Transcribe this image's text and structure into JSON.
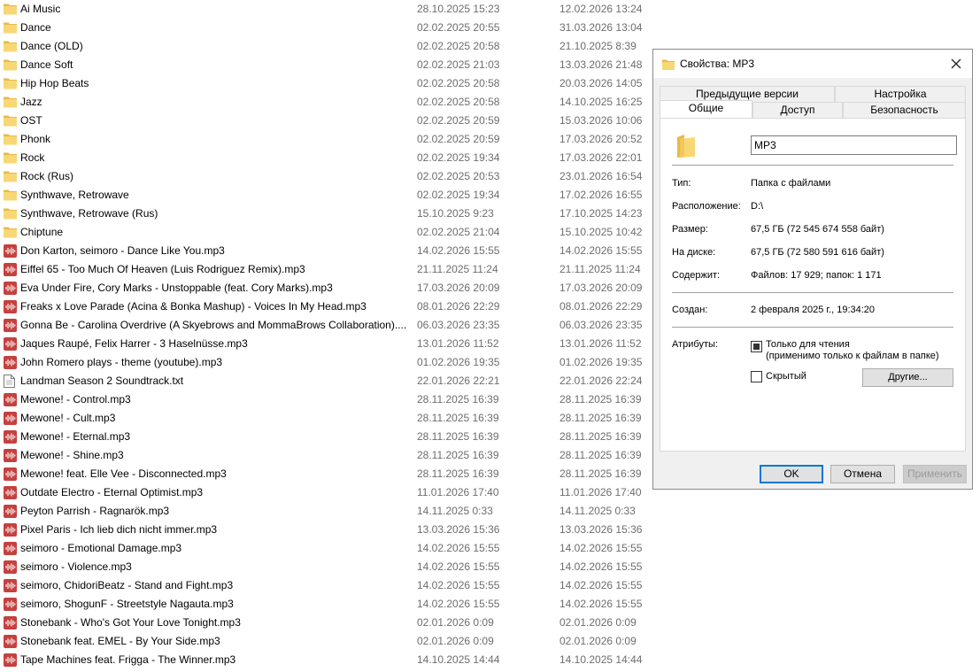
{
  "files": [
    {
      "name": "Ai Music",
      "type": "folder",
      "created": "28.10.2025 15:23",
      "modified": "12.02.2026 13:24"
    },
    {
      "name": "Dance",
      "type": "folder",
      "created": "02.02.2025 20:55",
      "modified": "31.03.2026 13:04"
    },
    {
      "name": "Dance (OLD)",
      "type": "folder",
      "created": "02.02.2025 20:58",
      "modified": "21.10.2025 8:39"
    },
    {
      "name": "Dance Soft",
      "type": "folder",
      "created": "02.02.2025 21:03",
      "modified": "13.03.2026 21:48"
    },
    {
      "name": "Hip Hop Beats",
      "type": "folder",
      "created": "02.02.2025 20:58",
      "modified": "20.03.2026 14:05"
    },
    {
      "name": "Jazz",
      "type": "folder",
      "created": "02.02.2025 20:58",
      "modified": "14.10.2025 16:25"
    },
    {
      "name": "OST",
      "type": "folder",
      "created": "02.02.2025 20:59",
      "modified": "15.03.2026 10:06"
    },
    {
      "name": "Phonk",
      "type": "folder",
      "created": "02.02.2025 20:59",
      "modified": "17.03.2026 20:52"
    },
    {
      "name": "Rock",
      "type": "folder",
      "created": "02.02.2025 19:34",
      "modified": "17.03.2026 22:01"
    },
    {
      "name": "Rock (Rus)",
      "type": "folder",
      "created": "02.02.2025 20:53",
      "modified": "23.01.2026 16:54"
    },
    {
      "name": "Synthwave, Retrowave",
      "type": "folder",
      "created": "02.02.2025 19:34",
      "modified": "17.02.2026 16:55"
    },
    {
      "name": "Synthwave, Retrowave (Rus)",
      "type": "folder",
      "created": "15.10.2025 9:23",
      "modified": "17.10.2025 14:23"
    },
    {
      "name": "Chiptune",
      "type": "folder",
      "created": "02.02.2025 21:04",
      "modified": "15.10.2025 10:42"
    },
    {
      "name": "Don Karton, seimoro - Dance Like You.mp3",
      "type": "audio",
      "created": "14.02.2026 15:55",
      "modified": "14.02.2026 15:55"
    },
    {
      "name": "Eiffel 65 - Too Much Of Heaven (Luis Rodriguez Remix).mp3",
      "type": "audio",
      "created": "21.11.2025 11:24",
      "modified": "21.11.2025 11:24"
    },
    {
      "name": "Eva Under Fire, Cory Marks - Unstoppable (feat. Cory Marks).mp3",
      "type": "audio",
      "created": "17.03.2026 20:09",
      "modified": "17.03.2026 20:09"
    },
    {
      "name": "Freaks x Love Parade (Acina & Bonka Mashup) - Voices In My Head.mp3",
      "type": "audio",
      "created": "08.01.2026 22:29",
      "modified": "08.01.2026 22:29"
    },
    {
      "name": "Gonna Be - Carolina Overdrive (A Skyebrows and MommaBrows Collaboration)....",
      "type": "audio",
      "created": "06.03.2026 23:35",
      "modified": "06.03.2026 23:35"
    },
    {
      "name": "Jaques Raupé, Felix Harrer - 3 Haselnüsse.mp3",
      "type": "audio",
      "created": "13.01.2026 11:52",
      "modified": "13.01.2026 11:52"
    },
    {
      "name": "John Romero plays - theme (youtube).mp3",
      "type": "audio",
      "created": "01.02.2026 19:35",
      "modified": "01.02.2026 19:35"
    },
    {
      "name": "Landman Season 2 Soundtrack.txt",
      "type": "text",
      "created": "22.01.2026 22:21",
      "modified": "22.01.2026 22:24"
    },
    {
      "name": "Mewone! - Control.mp3",
      "type": "audio",
      "created": "28.11.2025 16:39",
      "modified": "28.11.2025 16:39"
    },
    {
      "name": "Mewone! - Cult.mp3",
      "type": "audio",
      "created": "28.11.2025 16:39",
      "modified": "28.11.2025 16:39"
    },
    {
      "name": "Mewone! - Eternal.mp3",
      "type": "audio",
      "created": "28.11.2025 16:39",
      "modified": "28.11.2025 16:39"
    },
    {
      "name": "Mewone! - Shine.mp3",
      "type": "audio",
      "created": "28.11.2025 16:39",
      "modified": "28.11.2025 16:39"
    },
    {
      "name": "Mewone! feat. Elle Vee - Disconnected.mp3",
      "type": "audio",
      "created": "28.11.2025 16:39",
      "modified": "28.11.2025 16:39"
    },
    {
      "name": "Outdate Electro - Eternal Optimist.mp3",
      "type": "audio",
      "created": "11.01.2026 17:40",
      "modified": "11.01.2026 17:40"
    },
    {
      "name": "Peyton Parrish - Ragnarök.mp3",
      "type": "audio",
      "created": "14.11.2025 0:33",
      "modified": "14.11.2025 0:33"
    },
    {
      "name": "Pixel Paris - Ich lieb dich nicht immer.mp3",
      "type": "audio",
      "created": "13.03.2026 15:36",
      "modified": "13.03.2026 15:36"
    },
    {
      "name": "seimoro - Emotional Damage.mp3",
      "type": "audio",
      "created": "14.02.2026 15:55",
      "modified": "14.02.2026 15:55"
    },
    {
      "name": "seimoro - Violence.mp3",
      "type": "audio",
      "created": "14.02.2026 15:55",
      "modified": "14.02.2026 15:55"
    },
    {
      "name": "seimoro, ChidoriBeatz - Stand and Fight.mp3",
      "type": "audio",
      "created": "14.02.2026 15:55",
      "modified": "14.02.2026 15:55"
    },
    {
      "name": "seimoro, ShogunF - Streetstyle Nagauta.mp3",
      "type": "audio",
      "created": "14.02.2026 15:55",
      "modified": "14.02.2026 15:55"
    },
    {
      "name": "Stonebank - Who's Got Your Love Tonight.mp3",
      "type": "audio",
      "created": "02.01.2026 0:09",
      "modified": "02.01.2026 0:09"
    },
    {
      "name": "Stonebank feat. EMEL - By Your Side.mp3",
      "type": "audio",
      "created": "02.01.2026 0:09",
      "modified": "02.01.2026 0:09"
    },
    {
      "name": "Tape Machines feat. Frigga - The Winner.mp3",
      "type": "audio",
      "created": "14.10.2025 14:44",
      "modified": "14.10.2025 14:44"
    }
  ],
  "icons": {
    "folder": "folder-icon",
    "audio": "audio-file-icon",
    "text": "text-file-icon"
  },
  "colors": {
    "folder": "#f8d775",
    "audio": "#c4413f",
    "accent": "#0078d7",
    "date_text": "#6d6d6d"
  },
  "dialog": {
    "title": "Свойства: MP3",
    "tabs_row1": [
      "Предыдущие версии",
      "Настройка"
    ],
    "tabs_row2": [
      "Общие",
      "Доступ",
      "Безопасность"
    ],
    "active_tab": "Общие",
    "folder_name": "MP3",
    "type_label": "Тип:",
    "type_value": "Папка с файлами",
    "location_label": "Расположение:",
    "location_value": "D:\\",
    "size_label": "Размер:",
    "size_value": "67,5 ГБ (72 545 674 558 байт)",
    "disk_label": "На диске:",
    "disk_value": "67,5 ГБ (72 580 591 616 байт)",
    "contains_label": "Содержит:",
    "contains_value": "Файлов: 17 929; папок: 1 171",
    "created_label": "Создан:",
    "created_value": "2 февраля 2025 г., 19:34:20",
    "attributes_label": "Атрибуты:",
    "readonly_label": "Только для чтения",
    "readonly_note": "(применимо только к файлам в папке)",
    "readonly_state": "indeterminate",
    "hidden_label": "Скрытый",
    "hidden_checked": false,
    "other_button": "Другие...",
    "ok_button": "OK",
    "cancel_button": "Отмена",
    "apply_button": "Применить"
  }
}
